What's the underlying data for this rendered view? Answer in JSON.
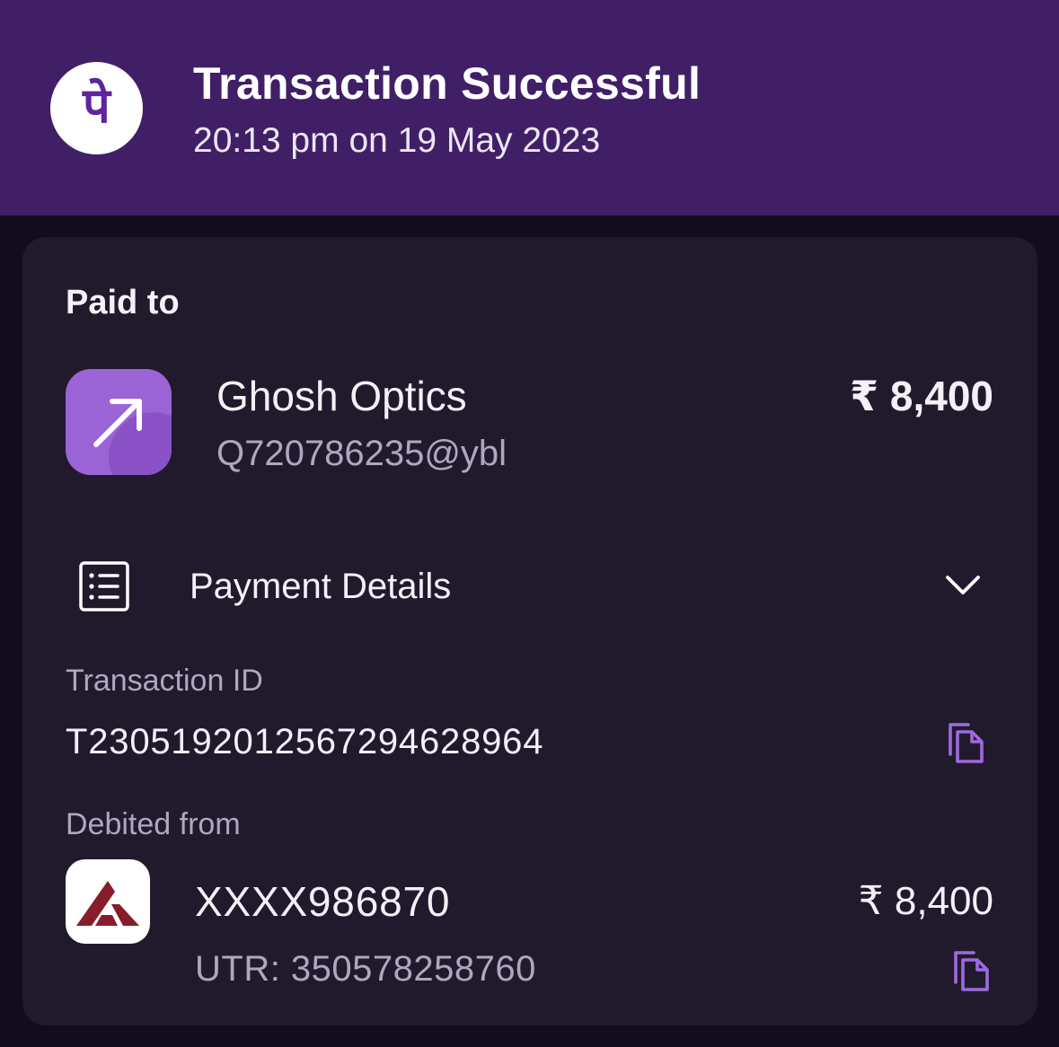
{
  "header": {
    "title": "Transaction Successful",
    "subtitle": "20:13 pm on 19 May 2023",
    "logo_glyph": "पे",
    "logo_icon": "phonepe-logo-icon"
  },
  "paid_to": {
    "label": "Paid to",
    "merchant_name": "Ghosh Optics",
    "merchant_upi": "Q720786235@ybl",
    "amount": "₹ 8,400",
    "icon": "arrow-up-right-icon"
  },
  "payment_details": {
    "label": "Payment Details",
    "icon": "receipt-list-icon",
    "toggle_icon": "chevron-down-icon"
  },
  "transaction": {
    "id_label": "Transaction ID",
    "id_value": "T2305192012567294628964",
    "copy_icon": "copy-icon"
  },
  "debit": {
    "label": "Debited from",
    "account": "XXXX986870",
    "utr": "UTR: 350578258760",
    "amount": "₹ 8,400",
    "bank_icon": "axis-bank-logo-icon",
    "copy_icon": "copy-icon"
  },
  "colors": {
    "header_bg": "#411f67",
    "page_bg": "#120c1c",
    "card_bg": "#211a2c",
    "accent": "#9b64d6",
    "bank_brand": "#871d2b"
  }
}
